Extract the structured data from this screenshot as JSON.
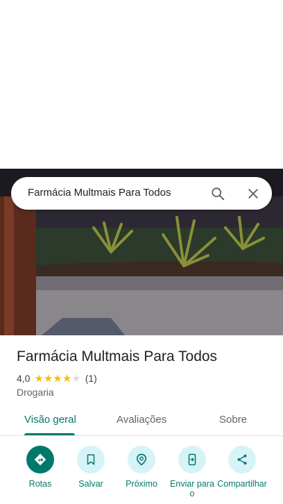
{
  "search": {
    "query": "Farmácia Multmais Para Todos",
    "search_icon": "search-icon",
    "close_icon": "close-icon"
  },
  "place": {
    "name": "Farmácia Multmais Para Todos",
    "rating": "4,0",
    "rating_value": 4.0,
    "stars_max": 5,
    "review_count": "(1)",
    "category": "Drogaria"
  },
  "tabs": [
    {
      "label": "Visão geral",
      "active": true
    },
    {
      "label": "Avaliações",
      "active": false
    },
    {
      "label": "Sobre",
      "active": false
    }
  ],
  "actions": [
    {
      "label": "Rotas",
      "icon": "directions-icon"
    },
    {
      "label": "Salvar",
      "icon": "bookmark-icon"
    },
    {
      "label": "Próximo",
      "icon": "nearby-icon"
    },
    {
      "label": "Enviar para o",
      "icon": "send-to-phone-icon"
    },
    {
      "label": "Compartilhar",
      "icon": "share-icon"
    }
  ],
  "colors": {
    "accent": "#00796b",
    "action_bg": "#d6f3f7",
    "star": "#fbbc04"
  }
}
